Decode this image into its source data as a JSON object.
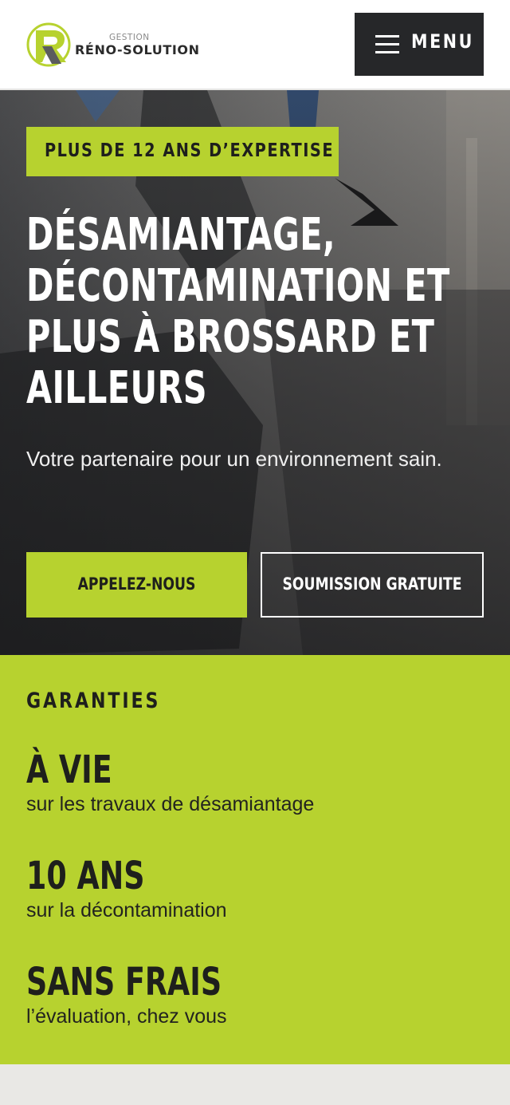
{
  "header": {
    "logo_letter": "R",
    "logo_small": "GESTION",
    "logo_name": "RÉNO-SOLUTION",
    "menu_label": "MENU",
    "menu_icon": "hamburger-icon"
  },
  "hero": {
    "badge": "PLUS DE 12 ANS D’EXPERTISE",
    "title_lines": [
      "DÉSAMIANTAGE,",
      "DÉCONTAMINATION ET",
      "PLUS À BROSSARD ET",
      "AILLEURS"
    ],
    "subtitle": "Votre partenaire pour un environnement sain.",
    "cta_call": "APPELEZ-NOUS",
    "cta_quote": "SOUMISSION GRATUITE"
  },
  "guarantees": {
    "heading": "GARANTIES",
    "items": [
      {
        "value": "À VIE",
        "desc": "sur les travaux de désamiantage"
      },
      {
        "value": "10 ANS",
        "desc": "sur la décontamination"
      },
      {
        "value": "SANS FRAIS",
        "desc": "l’évaluation, chez vous"
      }
    ]
  },
  "colors": {
    "accent": "#b7d22f",
    "dark": "#262729",
    "text_dark": "#1e1f1c"
  }
}
